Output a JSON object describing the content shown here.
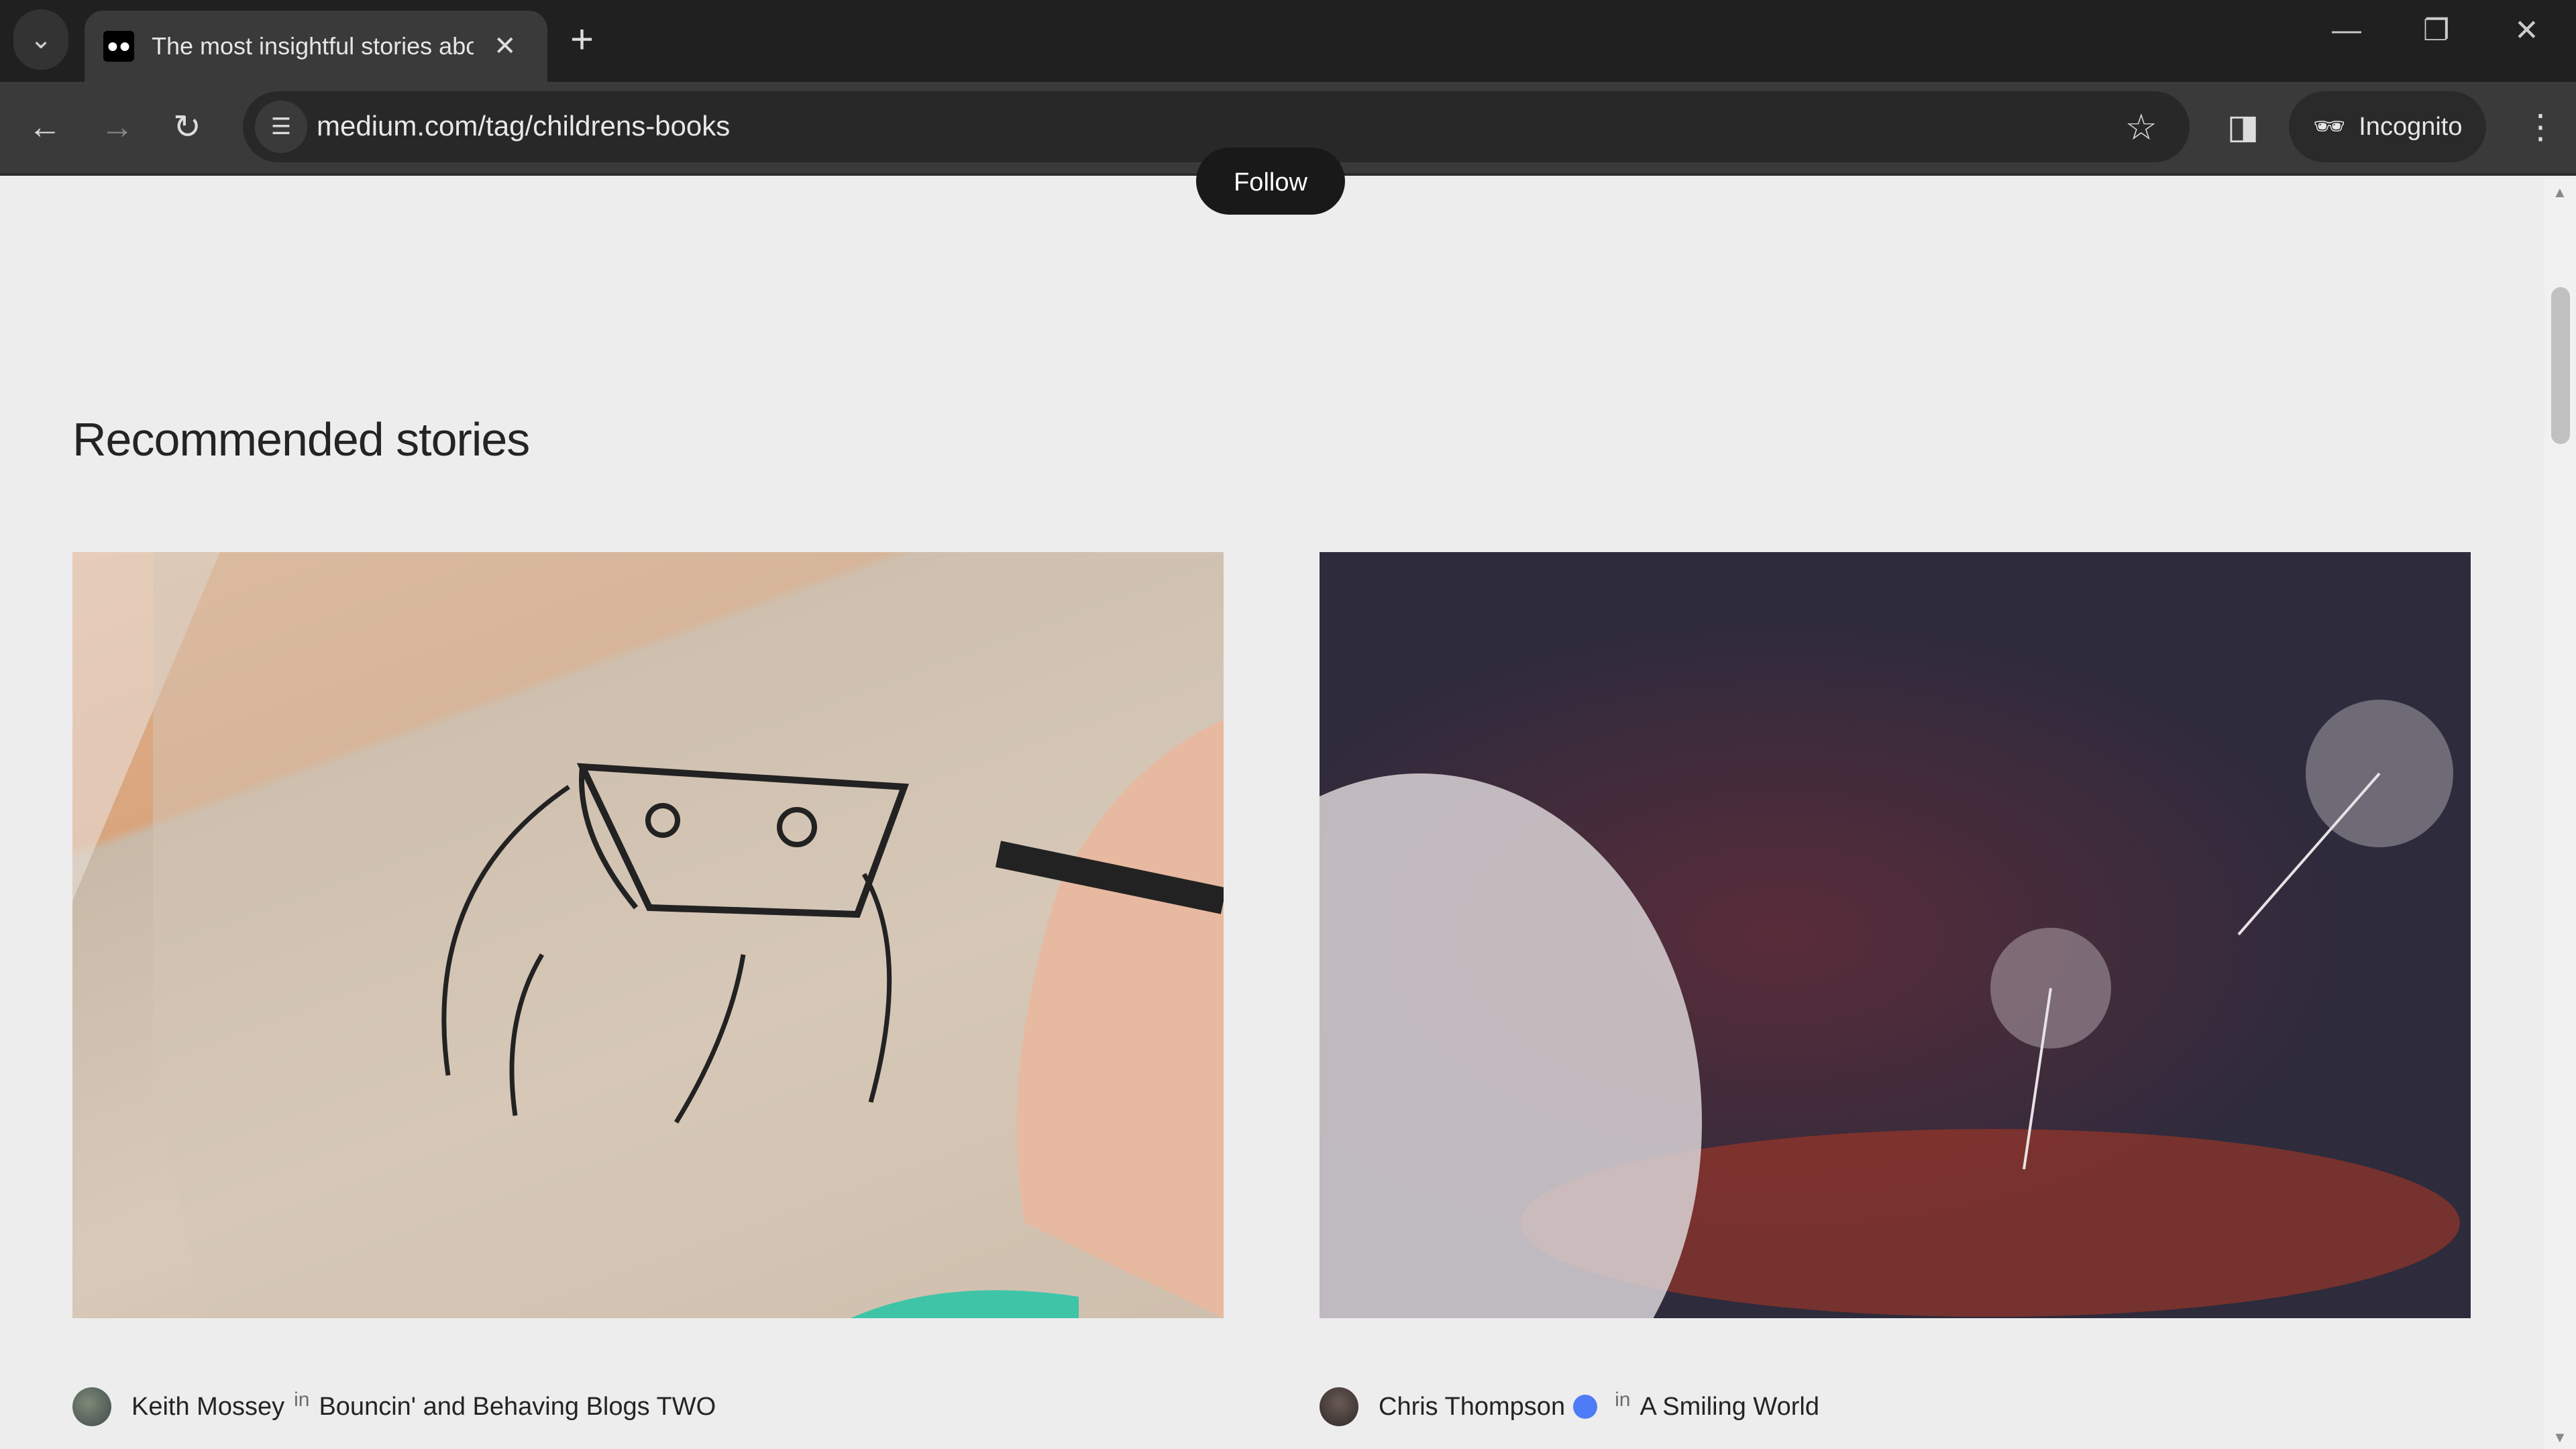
{
  "browser": {
    "tab_title": "The most insightful stories about Children's Books",
    "tab_title_visible": "The most insightful stories abou",
    "url": "medium.com/tag/childrens-books",
    "incognito_label": "Incognito"
  },
  "page": {
    "follow_label": "Follow",
    "section_title": "Recommended stories",
    "stories": [
      {
        "author": "Keith Mossey",
        "in": "in",
        "publication": "Bouncin' and Behaving Blogs TWO",
        "verified": false
      },
      {
        "author": "Chris Thompson",
        "in": "in",
        "publication": "A Smiling World",
        "verified": true
      }
    ]
  },
  "colors": {
    "accent": "#191919",
    "verified_badge": "#4d7cf6"
  }
}
